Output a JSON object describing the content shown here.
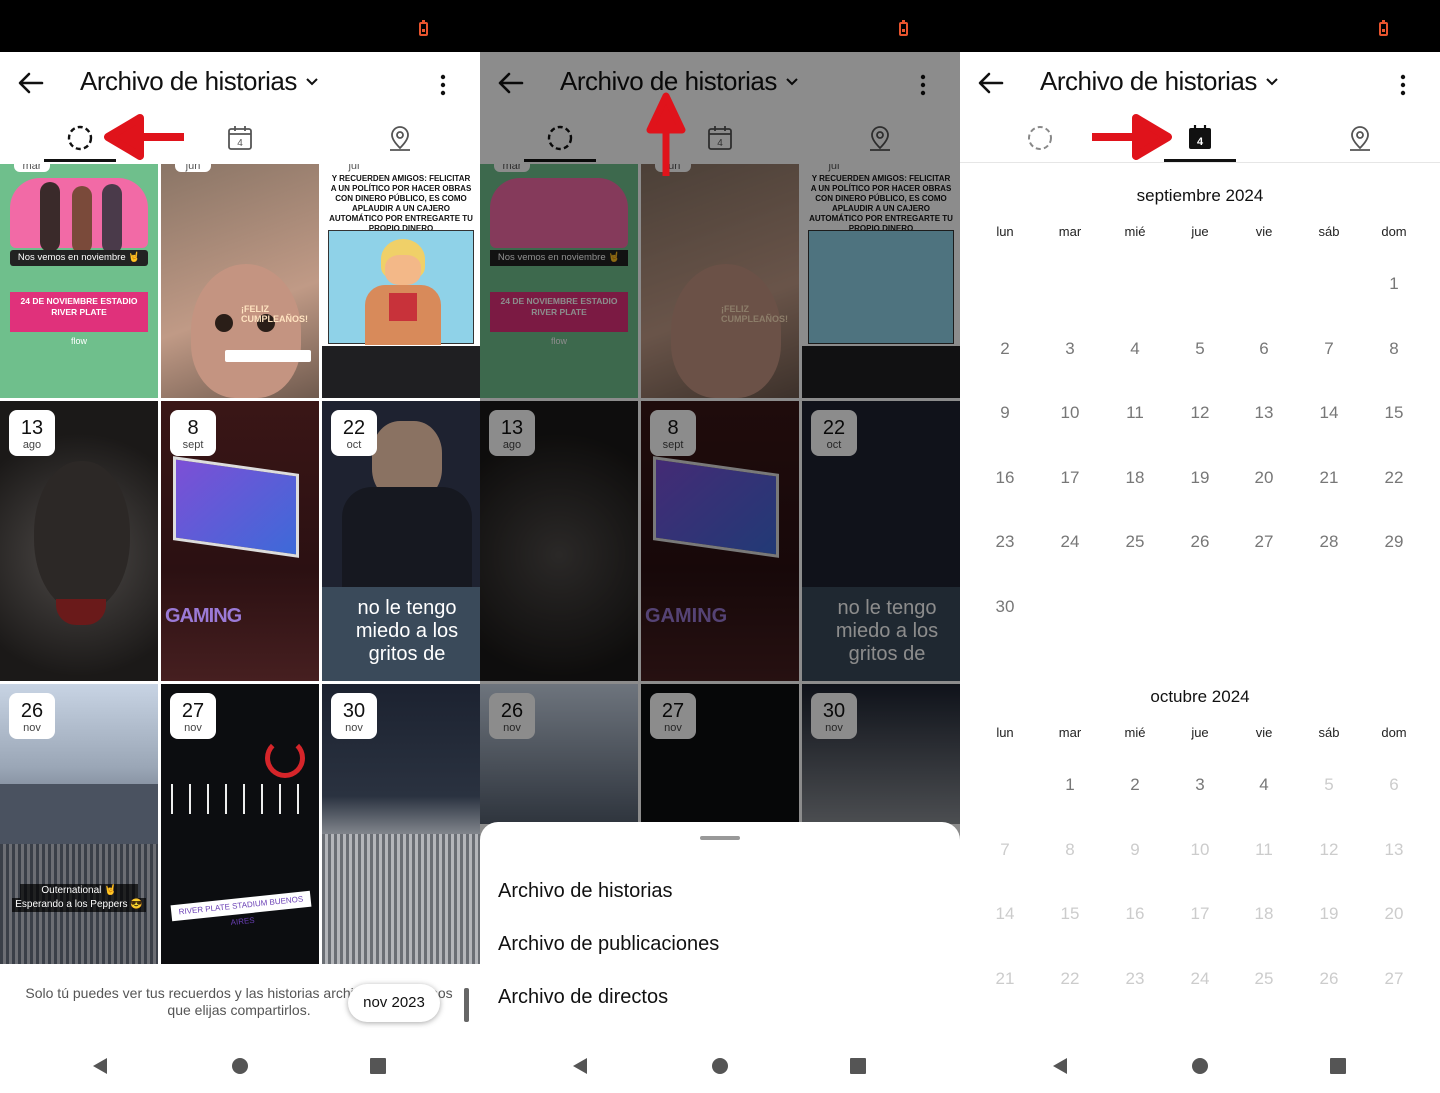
{
  "header": {
    "title": "Archivo de historias"
  },
  "tiles": [
    {
      "top_tag": "mar",
      "kind": "poster",
      "poster_text": "Nos vemos en noviembre 🤘",
      "poster_banner": "24 DE NOVIEMBRE ESTADIO RIVER PLATE",
      "poster_small": "flow"
    },
    {
      "top_tag": "jun",
      "kind": "face",
      "sticker": "¡FELIZ CUMPLEAÑOS!"
    },
    {
      "top_tag": "jul",
      "kind": "meme",
      "meme_text": "Y RECUERDEN AMIGOS: FELICITAR A UN POLÍTICO POR HACER OBRAS CON DINERO PÚBLICO, ES COMO APLAUDIR A UN CAJERO AUTOMÁTICO POR ENTREGARTE TU PROPIO DINERO"
    },
    {
      "day": "13",
      "month": "ago",
      "kind": "lion"
    },
    {
      "day": "8",
      "month": "sept",
      "kind": "screen",
      "caption": "GAMING"
    },
    {
      "day": "22",
      "month": "oct",
      "kind": "speech",
      "caption": "no le tengo miedo a los gritos de"
    },
    {
      "day": "26",
      "month": "nov",
      "kind": "stadium",
      "caption1": "Outernational 🤘",
      "caption2": "Esperando a los Peppers 😎"
    },
    {
      "day": "27",
      "month": "nov",
      "kind": "concert",
      "caption": "RIVER PLATE STADIUM BUENOS AIRES"
    },
    {
      "day": "30",
      "month": "nov",
      "kind": "crowd"
    }
  ],
  "footer": {
    "text": "Solo tú puedes ver tus recuerdos y las historias archivadas, a menos que elijas compartirlos.",
    "month_pill": "nov 2023"
  },
  "sheet": {
    "items": [
      "Archivo de historias",
      "Archivo de publicaciones",
      "Archivo de directos"
    ]
  },
  "calendar": {
    "weekdays": [
      "lun",
      "mar",
      "mié",
      "jue",
      "vie",
      "sáb",
      "dom"
    ],
    "months": [
      {
        "label": "septiembre 2024",
        "rows": [
          [
            "",
            "",
            "",
            "",
            "",
            "",
            "1"
          ],
          [
            "2",
            "3",
            "4",
            "5",
            "6",
            "7",
            "8"
          ],
          [
            "9",
            "10",
            "11",
            "12",
            "13",
            "14",
            "15"
          ],
          [
            "16",
            "17",
            "18",
            "19",
            "20",
            "21",
            "22"
          ],
          [
            "23",
            "24",
            "25",
            "26",
            "27",
            "28",
            "29"
          ],
          [
            "30",
            "",
            "",
            "",
            "",
            "",
            ""
          ]
        ],
        "active_until": 30
      },
      {
        "label": "octubre 2024",
        "rows": [
          [
            "",
            "1",
            "2",
            "3",
            "4",
            "5",
            "6"
          ],
          [
            "7",
            "8",
            "9",
            "10",
            "11",
            "12",
            "13"
          ],
          [
            "14",
            "15",
            "16",
            "17",
            "18",
            "19",
            "20"
          ],
          [
            "21",
            "22",
            "23",
            "24",
            "25",
            "26",
            "27"
          ]
        ],
        "active_until": 4
      }
    ]
  },
  "tab_icons": [
    "stories-ring-icon",
    "calendar-icon",
    "location-pin-icon"
  ],
  "calendar_icon_day": "4",
  "colors": {
    "accent_red": "#e0131b",
    "battery": "#e8542e",
    "status_bar": "#000000"
  }
}
